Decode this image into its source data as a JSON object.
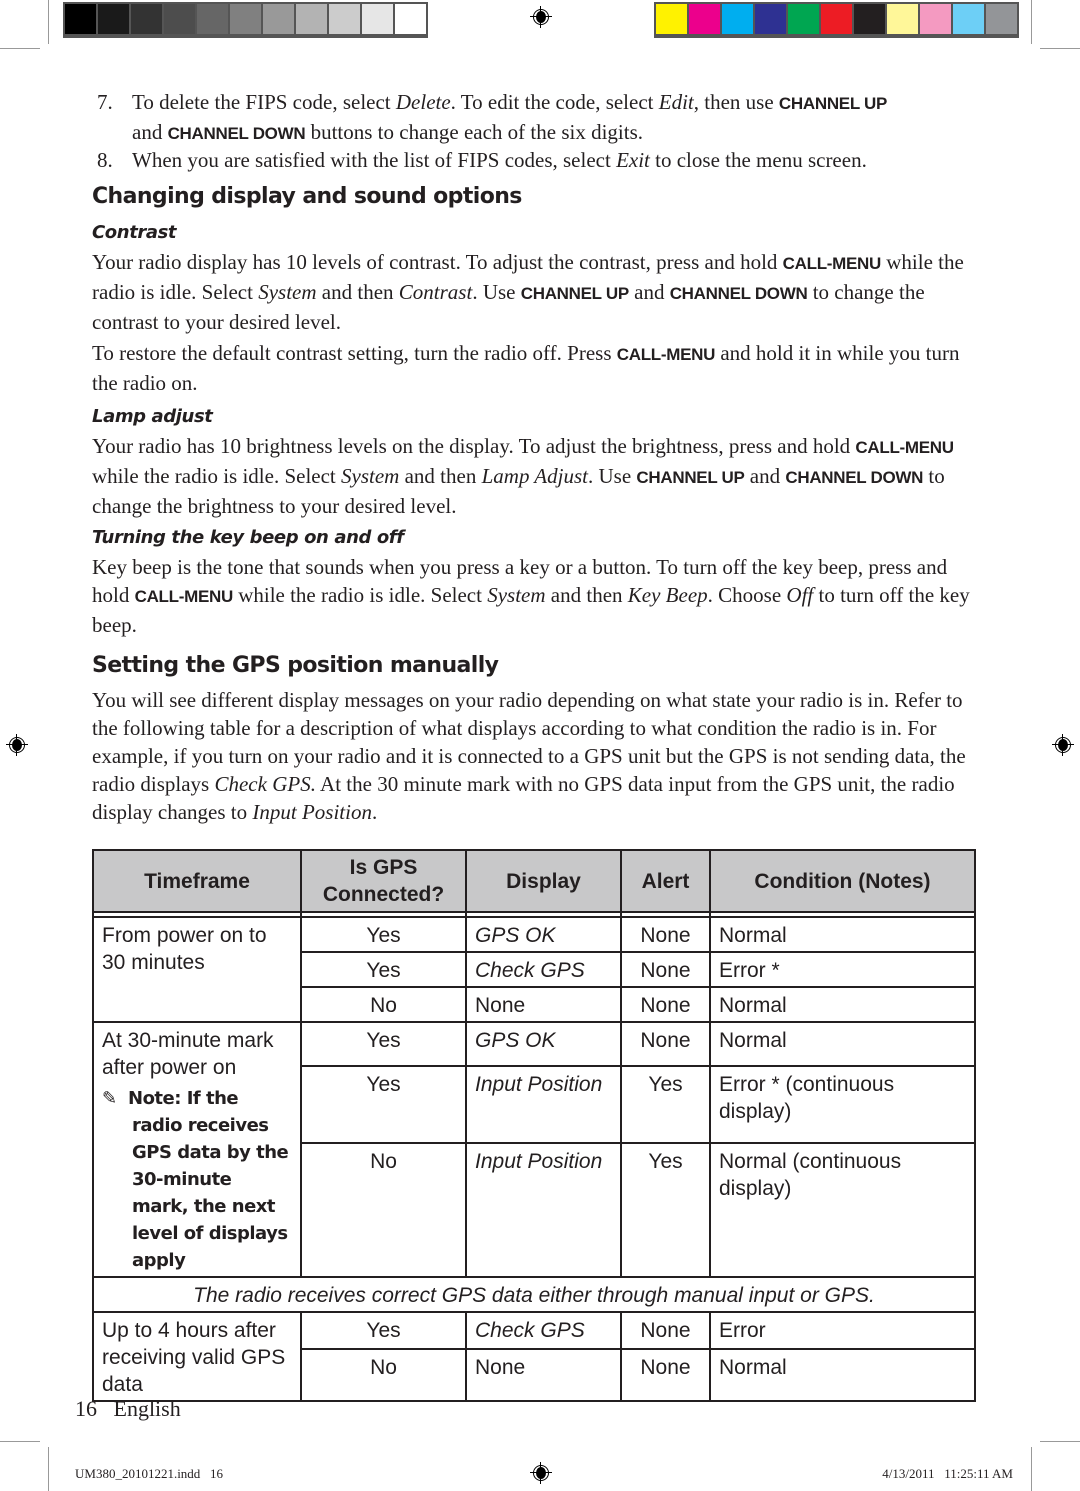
{
  "print_marks": {
    "grayscale_swatches": [
      "#000000",
      "#1a1a1a",
      "#333333",
      "#4d4d4d",
      "#666666",
      "#808080",
      "#999999",
      "#b3b3b3",
      "#cccccc",
      "#e6e6e6",
      "#ffffff"
    ],
    "color_swatches": [
      "#fff200",
      "#ec008c",
      "#00aeef",
      "#2e3192",
      "#00a651",
      "#ed1c24",
      "#231f20",
      "#fff799",
      "#f49ac1",
      "#6dcff6",
      "#939598"
    ]
  },
  "steps": [
    {
      "num": "7.",
      "line1_a": "To delete the FIPS code, select ",
      "line1_i1": "Delete",
      "line1_b": ". To edit the code, select ",
      "line1_i2": "Edit",
      "line1_c": ", then use ",
      "ui1": "CHANNEL UP",
      "line2_a": "and ",
      "ui2": "CHANNEL DOWN",
      "line2_b": " buttons to change each of the six digits."
    },
    {
      "num": "8.",
      "a": "When you are satisfied with the list of FIPS codes, select ",
      "i": "Exit",
      "b": " to close the menu screen."
    }
  ],
  "section1": {
    "title": "Changing display and sound options",
    "contrast": {
      "heading": "Contrast",
      "p1_a": "Your radio display has 10 levels of contrast. To adjust the contrast, press and hold ",
      "p1_ui1": "CALL-MENU",
      "p1_b": " while the radio is idle. Select ",
      "p1_i1": "System",
      "p1_c": " and then ",
      "p1_i2": "Contrast",
      "p1_d": ". Use ",
      "p1_ui2": "CHANNEL UP",
      "p1_e": " and ",
      "p1_ui3": "CHANNEL DOWN",
      "p1_f": " to change the contrast to your desired level.",
      "p2_a": "To restore the default contrast setting, turn the radio off. Press ",
      "p2_ui": "CALL-MENU",
      "p2_b": " and hold it in while you turn the radio on."
    },
    "lamp": {
      "heading": "Lamp adjust",
      "a": "Your radio has 10 brightness levels on the display. To adjust the brightness, press and hold ",
      "ui1": "CALL-MENU",
      "b": " while the radio is idle. Select ",
      "i1": "System",
      "c": " and then ",
      "i2": "Lamp Adjust",
      "d": ". Use ",
      "ui2": "CHANNEL UP",
      "e": " and ",
      "ui3": "CHANNEL DOWN",
      "f": " to change the brightness to your desired level."
    },
    "beep": {
      "heading": "Turning the key beep on and off",
      "a": "Key beep is the tone that sounds when you press a key or a button. To turn off the key beep, press and hold ",
      "ui": "CALL-MENU",
      "b": " while the radio is idle. Select ",
      "i1": "System",
      "c": " and then ",
      "i2": "Key Beep",
      "d": ". Choose ",
      "i3": "Off",
      "e": " to turn off the key beep."
    }
  },
  "section2": {
    "title": "Setting the GPS position manually",
    "a": "You will see different display messages on your radio depending on what state your radio is in. Refer to the following table for a description of what displays according to what condition the radio is in. For example, if you turn on your radio and it is  connected to a GPS unit but the GPS is not sending data, the radio displays ",
    "i1": "Check GPS.",
    "b": " At the 30 minute mark with no GPS data input from the GPS unit, the radio display changes to ",
    "i2": "Input Position",
    "c": "."
  },
  "table": {
    "headers": [
      "Timeframe",
      "Is GPS Connected?",
      "Display",
      "Alert",
      "Condition (Notes)"
    ],
    "group1": {
      "timeframe": "From power on to 30 minutes",
      "rows": [
        {
          "connected": "Yes",
          "display": "GPS OK",
          "alert": "None",
          "condition": "Normal"
        },
        {
          "connected": "Yes",
          "display": "Check GPS",
          "alert": "None",
          "condition": "Error *"
        },
        {
          "connected": "No",
          "display": "None",
          "alert": "None",
          "condition": "Normal"
        }
      ]
    },
    "group2": {
      "timeframe": "At 30-minute mark after power on",
      "note_first": "Note: If the",
      "note_rest": "radio receives GPS data by the 30-minute mark, the next level of displays apply",
      "rows": [
        {
          "connected": "Yes",
          "display": "GPS OK",
          "alert": "None",
          "condition": "Normal"
        },
        {
          "connected": "Yes",
          "display": "Input Position",
          "alert": "Yes",
          "condition": "Error * (continuous display)"
        },
        {
          "connected": "No",
          "display": "Input Position",
          "alert": "Yes",
          "condition": "Normal (continuous display)"
        }
      ]
    },
    "banner": "The radio receives correct GPS data either through manual input or GPS.",
    "group3": {
      "timeframe": "Up to 4 hours after receiving valid GPS data",
      "rows": [
        {
          "connected": "Yes",
          "display": "Check GPS",
          "alert": "None",
          "condition": "Error"
        },
        {
          "connected": "No",
          "display": "None",
          "alert": "None",
          "condition": "Normal"
        }
      ]
    }
  },
  "page_footer": {
    "page_number": "16",
    "language": "English"
  },
  "slug": {
    "file": "UM380_20101221.indd   16",
    "timestamp": "4/13/2011   11:25:11 AM"
  }
}
